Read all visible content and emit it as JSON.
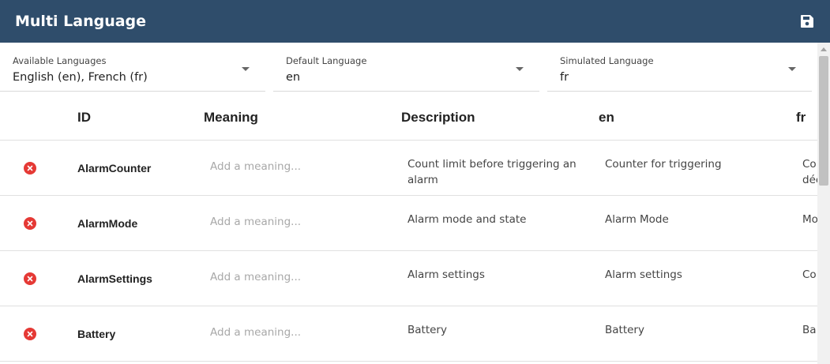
{
  "header": {
    "title": "Multi Language",
    "save_icon": "floppy-disk-icon"
  },
  "selects": {
    "available": {
      "label": "Available Languages",
      "value": "English (en), French (fr)"
    },
    "default": {
      "label": "Default Language",
      "value": "en"
    },
    "simulated": {
      "label": "Simulated Language",
      "value": "fr"
    }
  },
  "table": {
    "columns": [
      "ID",
      "Meaning",
      "Description",
      "en",
      "fr"
    ],
    "meaning_placeholder": "Add a meaning...",
    "rows": [
      {
        "id": "AlarmCounter",
        "description": "Count limit before triggering an alarm",
        "en": "Counter for triggering",
        "fr": "Co déc"
      },
      {
        "id": "AlarmMode",
        "description": "Alarm mode and state",
        "en": "Alarm Mode",
        "fr": "Mo"
      },
      {
        "id": "AlarmSettings",
        "description": "Alarm settings",
        "en": "Alarm settings",
        "fr": "Co"
      },
      {
        "id": "Battery",
        "description": "Battery",
        "en": "Battery",
        "fr": "Ba"
      }
    ]
  },
  "colors": {
    "header_bg": "#2f4d6b",
    "delete_red": "#e53935"
  }
}
